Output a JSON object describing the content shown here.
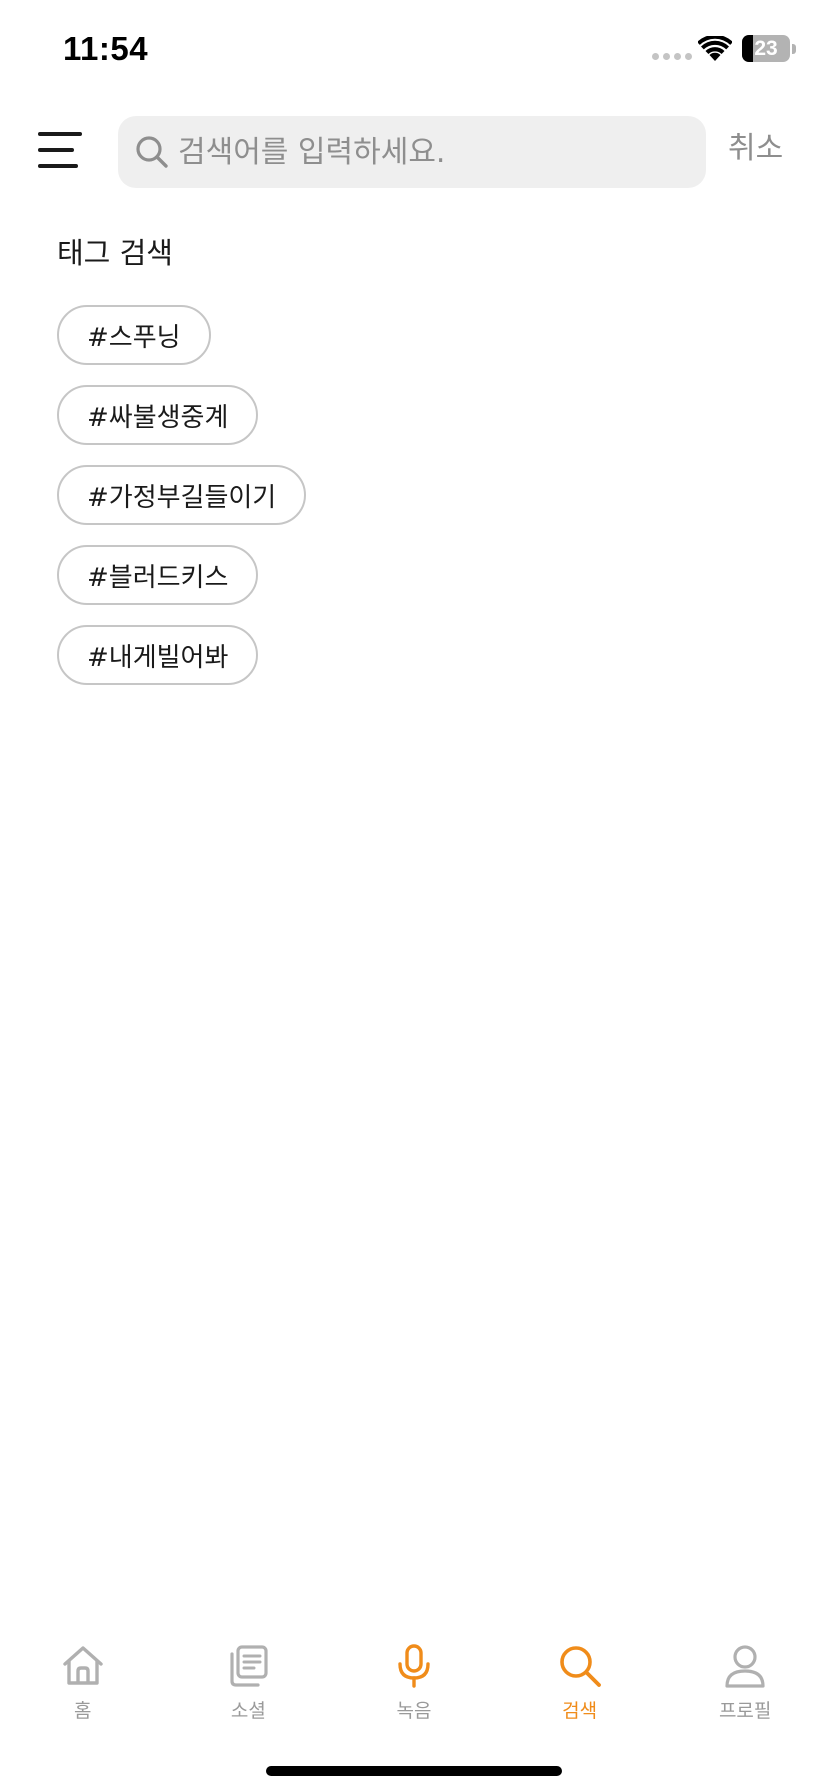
{
  "status_bar": {
    "time": "11:54",
    "battery": "23"
  },
  "header": {
    "menu_icon": "hamburger-menu-icon",
    "search_placeholder": "검색어를 입력하세요.",
    "search_value": "",
    "cancel_label": "취소"
  },
  "tag_section": {
    "title": "태그 검색",
    "tags": [
      "#스푸닝",
      "#싸불생중계",
      "#가정부길들이기",
      "#블러드키스",
      "#내게빌어봐"
    ]
  },
  "tab_bar": {
    "items": [
      {
        "label": "홈",
        "icon": "home-icon"
      },
      {
        "label": "소셜",
        "icon": "social-icon"
      },
      {
        "label": "녹음",
        "icon": "microphone-icon"
      },
      {
        "label": "검색",
        "icon": "search-icon"
      },
      {
        "label": "프로필",
        "icon": "profile-icon"
      }
    ],
    "active": "검색"
  },
  "colors": {
    "accent": "#f08c1a",
    "inactive": "#b0b0b0",
    "search_bg": "#efefef",
    "tag_border": "#c6c6c6"
  }
}
